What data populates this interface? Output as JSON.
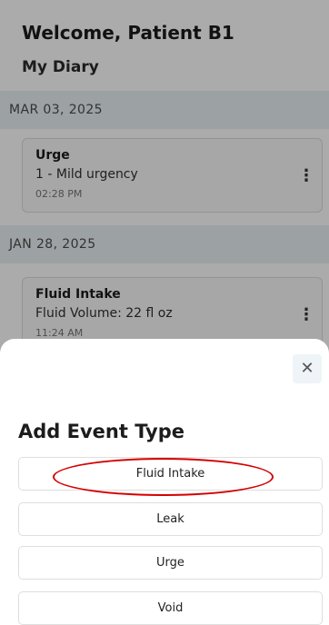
{
  "header": {
    "welcome": "Welcome, Patient B1",
    "diary_title": "My Diary"
  },
  "diary": [
    {
      "date": "MAR 03, 2025",
      "entry": {
        "title": "Urge",
        "detail": "1 - Mild urgency",
        "time": "02:28 PM",
        "menu_icon": "more-vertical-icon"
      }
    },
    {
      "date": "JAN 28, 2025",
      "entry": {
        "title": "Fluid Intake",
        "detail": "Fluid Volume: 22 fl oz",
        "time": "11:24 AM",
        "menu_icon": "more-vertical-icon"
      }
    }
  ],
  "modal": {
    "close_icon": "close-icon",
    "title": "Add Event Type",
    "options": [
      "Fluid Intake",
      "Leak",
      "Urge",
      "Void"
    ],
    "highlighted_option": "Fluid Intake"
  },
  "colors": {
    "date_header_bg": "#e9f0f4",
    "overlay": "rgba(0,0,0,0.33)",
    "annotation_red": "#d40000"
  }
}
